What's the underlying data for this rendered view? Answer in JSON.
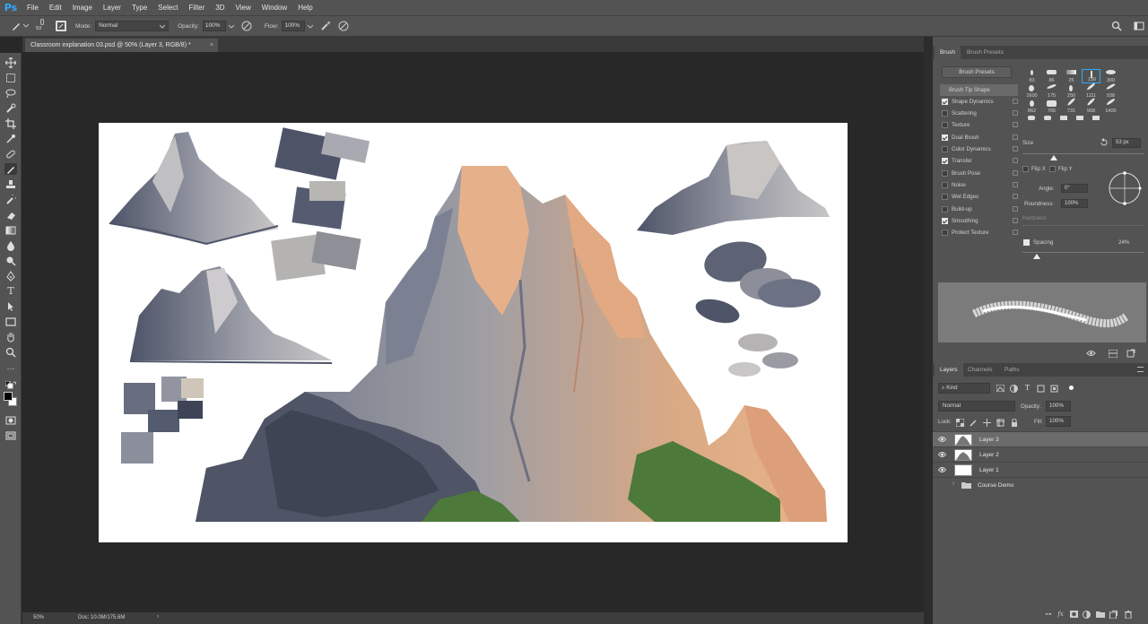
{
  "app": {
    "logo": "Ps"
  },
  "menu": [
    "File",
    "Edit",
    "Image",
    "Layer",
    "Type",
    "Select",
    "Filter",
    "3D",
    "View",
    "Window",
    "Help"
  ],
  "options_bar": {
    "brush_size": "53",
    "mode_label": "Mode:",
    "mode_value": "Normal",
    "opacity_label": "Opacity:",
    "opacity_value": "100%",
    "flow_label": "Flow:",
    "flow_value": "100%"
  },
  "document": {
    "tab_title": "Classroom explanation 03.psd @ 50% (Layer 3, RGB/8) *",
    "close_glyph": "×"
  },
  "status": {
    "zoom": "50%",
    "doc_info": "Doc: 10.0M/175.6M",
    "arrow": "›"
  },
  "brush_panel": {
    "tabs": [
      "Brush",
      "Brush Presets"
    ],
    "presets_button": "Brush Presets",
    "sections": [
      {
        "label": "Brush Tip Shape",
        "checked": null
      },
      {
        "label": "Shape Dynamics",
        "checked": true
      },
      {
        "label": "Scattering",
        "checked": false
      },
      {
        "label": "Texture",
        "checked": false
      },
      {
        "label": "Dual Brush",
        "checked": true
      },
      {
        "label": "Color Dynamics",
        "checked": false
      },
      {
        "label": "Transfer",
        "checked": true
      },
      {
        "label": "Brush Pose",
        "checked": false
      },
      {
        "label": "Noise",
        "checked": false
      },
      {
        "label": "Wet Edges",
        "checked": false
      },
      {
        "label": "Build-up",
        "checked": false
      },
      {
        "label": "Smoothing",
        "checked": true
      },
      {
        "label": "Protect Texture",
        "checked": false
      }
    ],
    "tip_sizes": [
      "83",
      "86",
      "25",
      "150",
      "300",
      "1600",
      "175",
      "250",
      "1111",
      "938",
      "862",
      "766",
      "731",
      "968",
      "1400"
    ],
    "size_label": "Size",
    "size_value": "53 px",
    "flip_x": "Flip X",
    "flip_y": "Flip Y",
    "angle_label": "Angle:",
    "angle_value": "0°",
    "roundness_label": "Roundness:",
    "roundness_value": "100%",
    "hardness_label": "Hardness",
    "spacing_label": "Spacing",
    "spacing_value": "24%"
  },
  "layers_panel": {
    "tabs": [
      "Layers",
      "Channels",
      "Paths"
    ],
    "kind_label": "Kind",
    "blend_mode": "Normal",
    "opacity_label": "Opacity:",
    "opacity_value": "100%",
    "lock_label": "Lock:",
    "fill_label": "Fill:",
    "fill_value": "100%",
    "layers": [
      {
        "name": "Layer 3",
        "selected": true
      },
      {
        "name": "Layer 2",
        "selected": false
      },
      {
        "name": "Layer 1",
        "selected": false
      }
    ],
    "group_name": "Course Demo"
  },
  "colors": {
    "ui_bg": "#535353",
    "dark_bg": "#282828",
    "accent": "#31a8ff",
    "rock_light": "#e8b48a",
    "rock_mid": "#8f8f9c",
    "rock_dark": "#4e5468",
    "veg": "#4d7a3a"
  }
}
